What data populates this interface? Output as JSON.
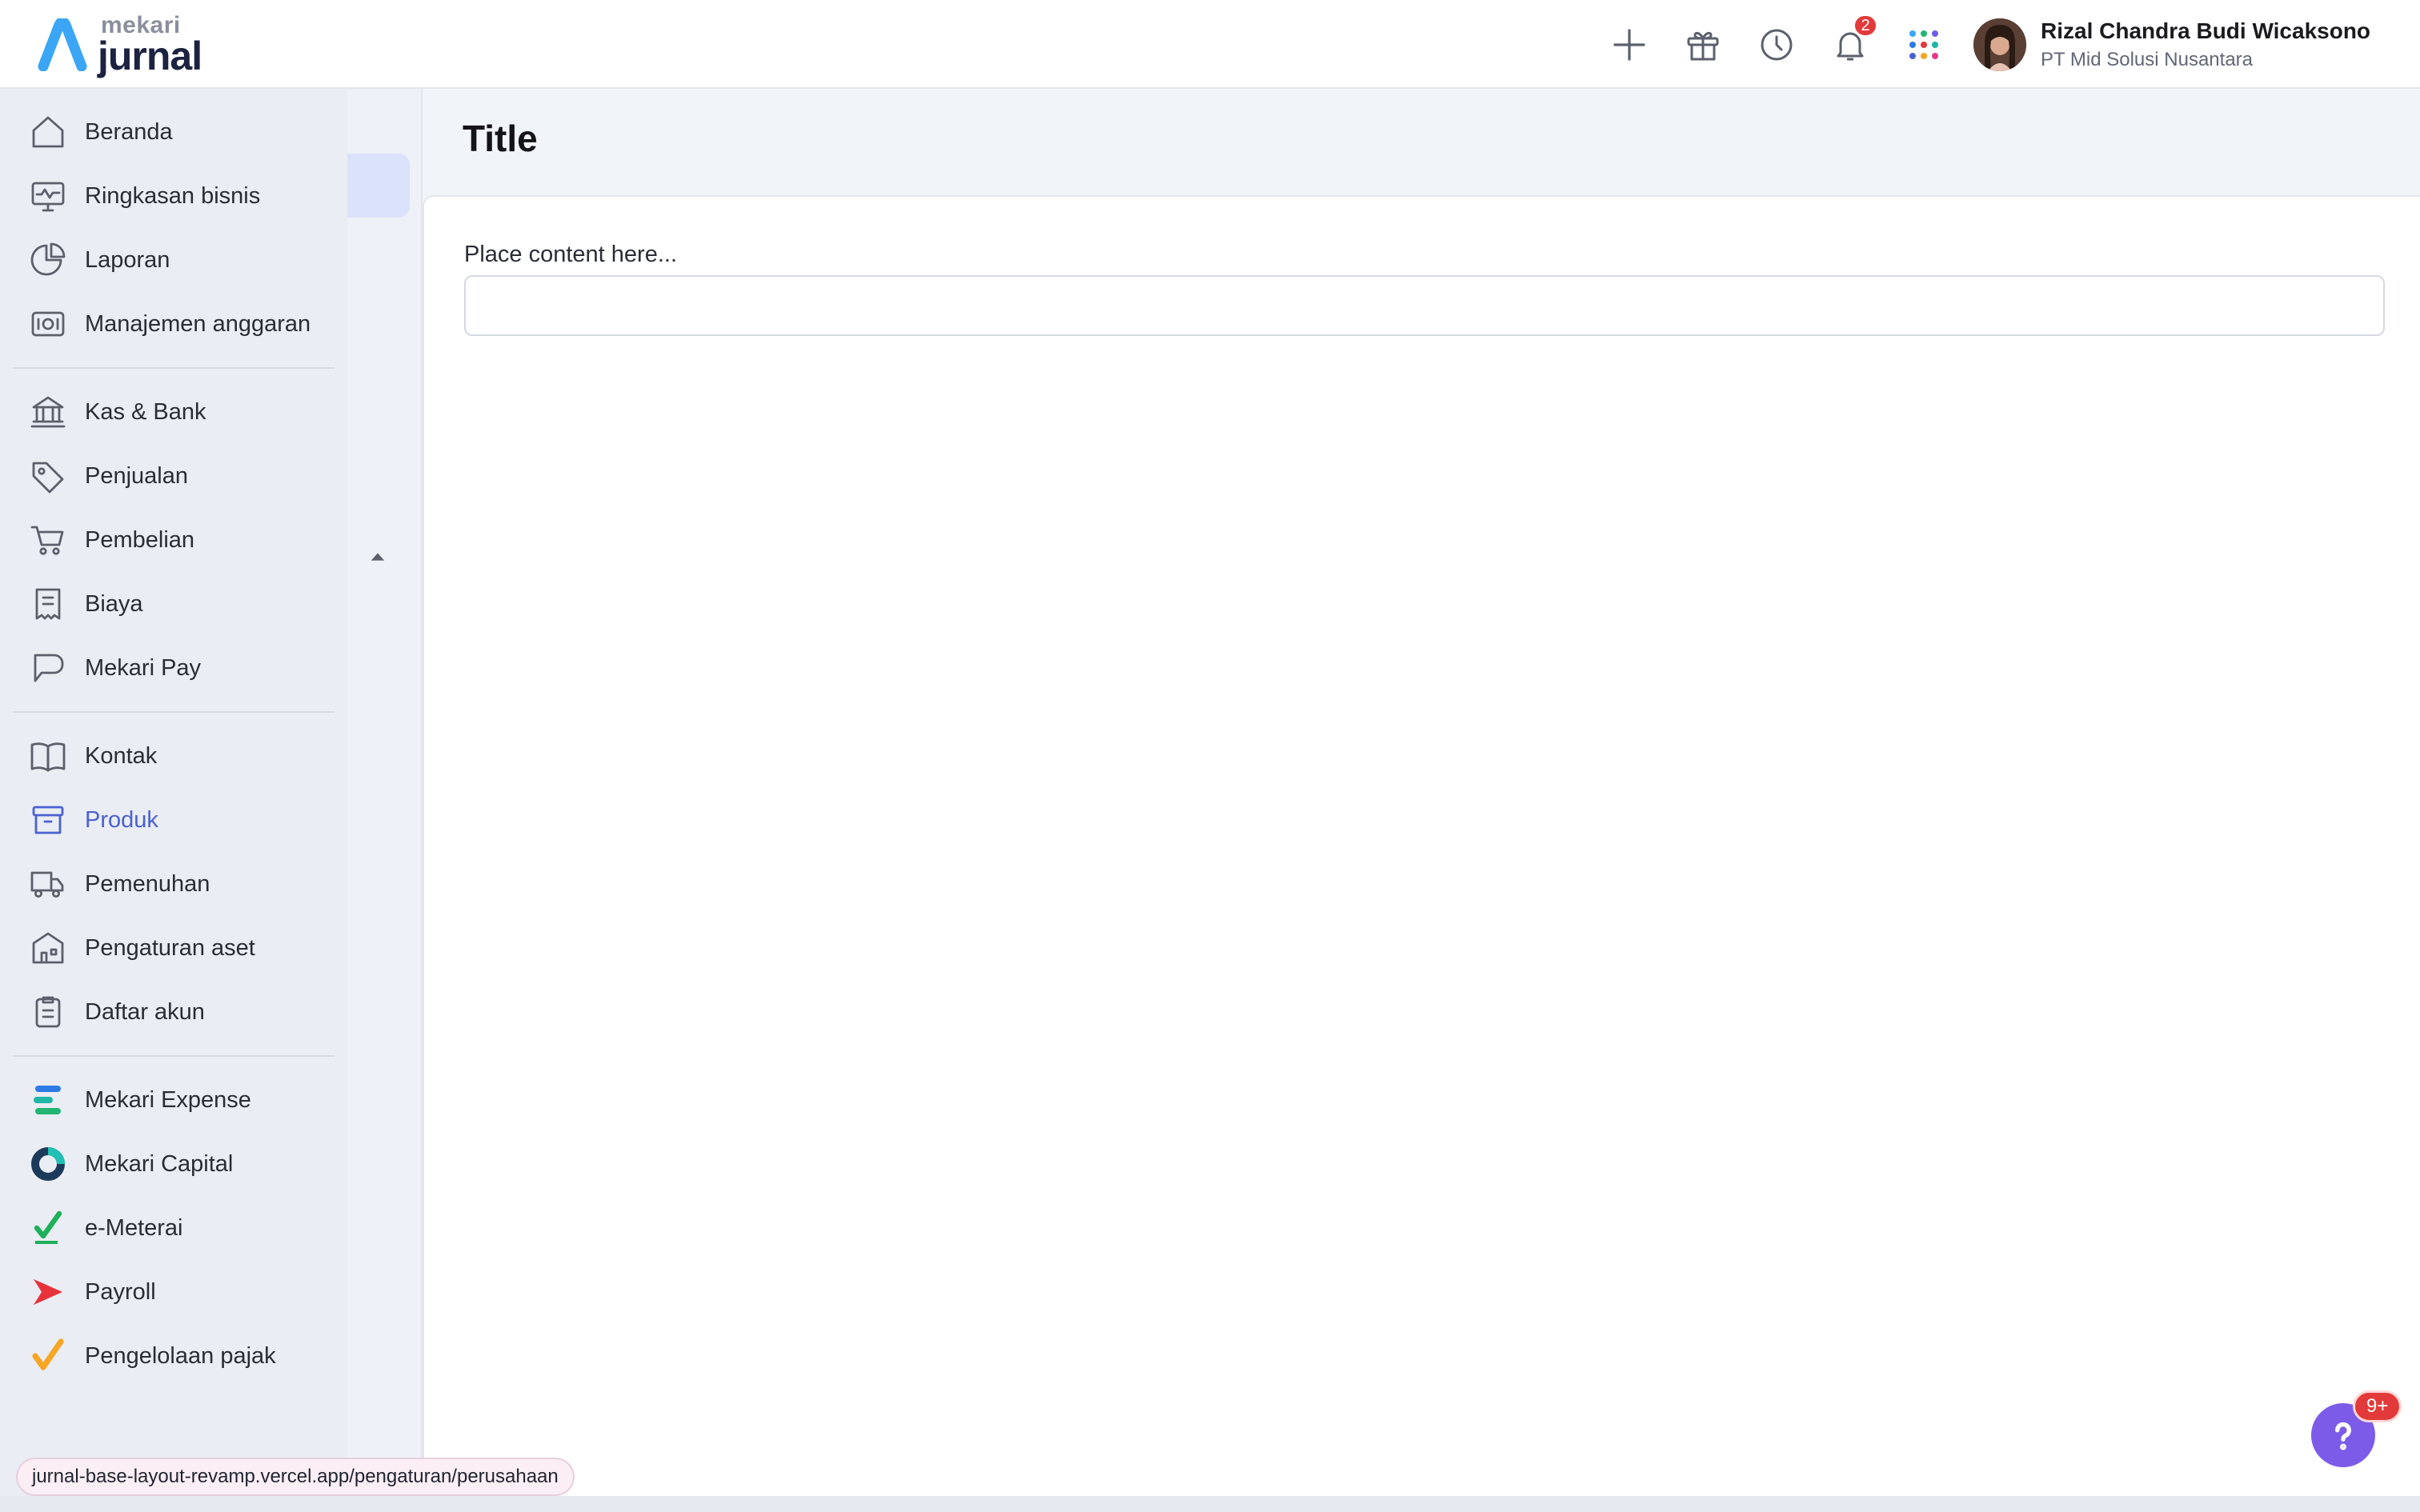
{
  "brand": {
    "sub": "mekari",
    "main": "jurnal"
  },
  "header": {
    "notification_count": "2",
    "user_name": "Rizal Chandra Budi Wicaksono",
    "user_company": "PT Mid Solusi Nusantara"
  },
  "sidebar": {
    "groups": [
      [
        {
          "label": "Beranda",
          "icon": "home-icon"
        },
        {
          "label": "Ringkasan bisnis",
          "icon": "monitor-chart-icon"
        },
        {
          "label": "Laporan",
          "icon": "pie-chart-icon"
        },
        {
          "label": "Manajemen anggaran",
          "icon": "budget-icon"
        }
      ],
      [
        {
          "label": "Kas & Bank",
          "icon": "bank-icon"
        },
        {
          "label": "Penjualan",
          "icon": "tag-icon"
        },
        {
          "label": "Pembelian",
          "icon": "cart-icon"
        },
        {
          "label": "Biaya",
          "icon": "receipt-icon"
        },
        {
          "label": "Mekari Pay",
          "icon": "chat-bubble-icon"
        }
      ],
      [
        {
          "label": "Kontak",
          "icon": "book-icon"
        },
        {
          "label": "Produk",
          "icon": "archive-box-icon",
          "active": true
        },
        {
          "label": "Pemenuhan",
          "icon": "truck-icon"
        },
        {
          "label": "Pengaturan aset",
          "icon": "building-icon"
        },
        {
          "label": "Daftar akun",
          "icon": "clipboard-icon"
        }
      ],
      [
        {
          "label": "Mekari Expense",
          "icon": "mekari-expense-icon"
        },
        {
          "label": "Mekari Capital",
          "icon": "mekari-capital-icon"
        },
        {
          "label": "e-Meterai",
          "icon": "e-meterai-icon"
        },
        {
          "label": "Payroll",
          "icon": "payroll-icon"
        },
        {
          "label": "Pengelolaan pajak",
          "icon": "tax-icon"
        }
      ]
    ]
  },
  "main": {
    "title": "Title",
    "field_label": "Place content here..."
  },
  "status_bar": {
    "url": "jurnal-base-layout-revamp.vercel.app/pengaturan/perusahaan"
  },
  "help": {
    "badge": "9+"
  },
  "colors": {
    "accent": "#4b61d1",
    "help": "#7c5be8",
    "badge": "#e23a3a"
  }
}
